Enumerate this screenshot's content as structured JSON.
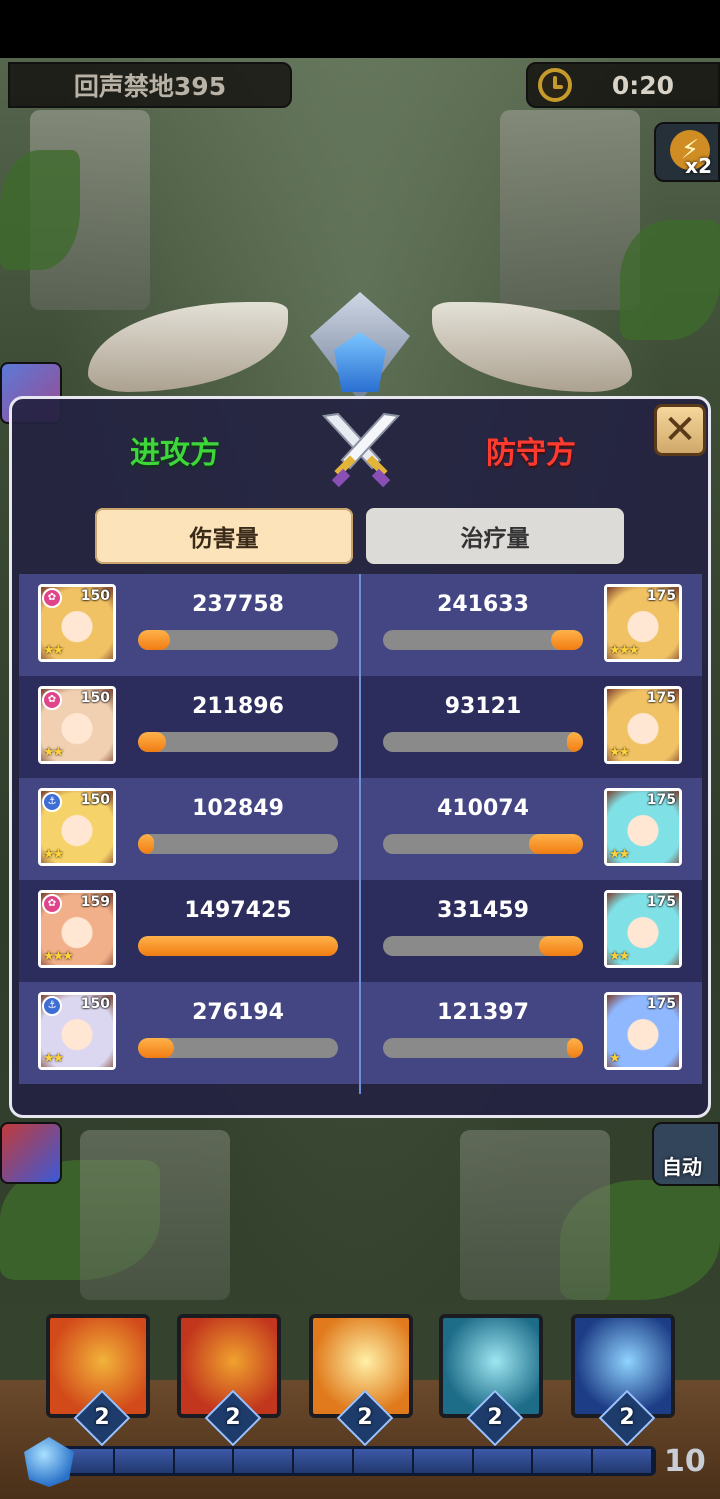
{
  "header": {
    "stage_name": "回声禁地395",
    "timer": "0:20",
    "speed_label": "x2"
  },
  "panel": {
    "attacker_title": "进攻方",
    "defender_title": "防守方",
    "tabs": [
      {
        "label": "伤害量",
        "active": true
      },
      {
        "label": "治疗量",
        "active": false
      }
    ],
    "rows": [
      {
        "attacker": {
          "level": "150",
          "faction": "pink",
          "stars": "★★",
          "value": "237758",
          "fill": 0.16
        },
        "defender": {
          "level": "175",
          "faction": "none",
          "stars": "★★★",
          "value": "241633",
          "fill": 0.16
        }
      },
      {
        "attacker": {
          "level": "150",
          "faction": "pink",
          "stars": "★★",
          "value": "211896",
          "fill": 0.14
        },
        "defender": {
          "level": "175",
          "faction": "none",
          "stars": "★★",
          "value": "93121",
          "fill": 0.06
        }
      },
      {
        "attacker": {
          "level": "150",
          "faction": "blue",
          "stars": "★★",
          "value": "102849",
          "fill": 0.07
        },
        "defender": {
          "level": "175",
          "faction": "none",
          "stars": "★★",
          "value": "410074",
          "fill": 0.27
        }
      },
      {
        "attacker": {
          "level": "159",
          "faction": "pink",
          "stars": "★★★",
          "value": "1497425",
          "fill": 1.0
        },
        "defender": {
          "level": "175",
          "faction": "none",
          "stars": "★★",
          "value": "331459",
          "fill": 0.22
        }
      },
      {
        "attacker": {
          "level": "150",
          "faction": "blue",
          "stars": "★★",
          "value": "276194",
          "fill": 0.18
        },
        "defender": {
          "level": "175",
          "faction": "none",
          "stars": "★",
          "value": "121397",
          "fill": 0.08
        }
      }
    ]
  },
  "skills": [
    {
      "cost": "2",
      "color_a": "#d24a1a",
      "color_b": "#f2b33a"
    },
    {
      "cost": "2",
      "color_a": "#c2361d",
      "color_b": "#f0a22e"
    },
    {
      "cost": "2",
      "color_a": "#e07a1c",
      "color_b": "#fff0a6"
    },
    {
      "cost": "2",
      "color_a": "#1d6c88",
      "color_b": "#9ee6f2"
    },
    {
      "cost": "2",
      "color_a": "#1d3d86",
      "color_b": "#8fd3ff"
    }
  ],
  "energy": {
    "count": "10"
  },
  "auto_label": "自动"
}
